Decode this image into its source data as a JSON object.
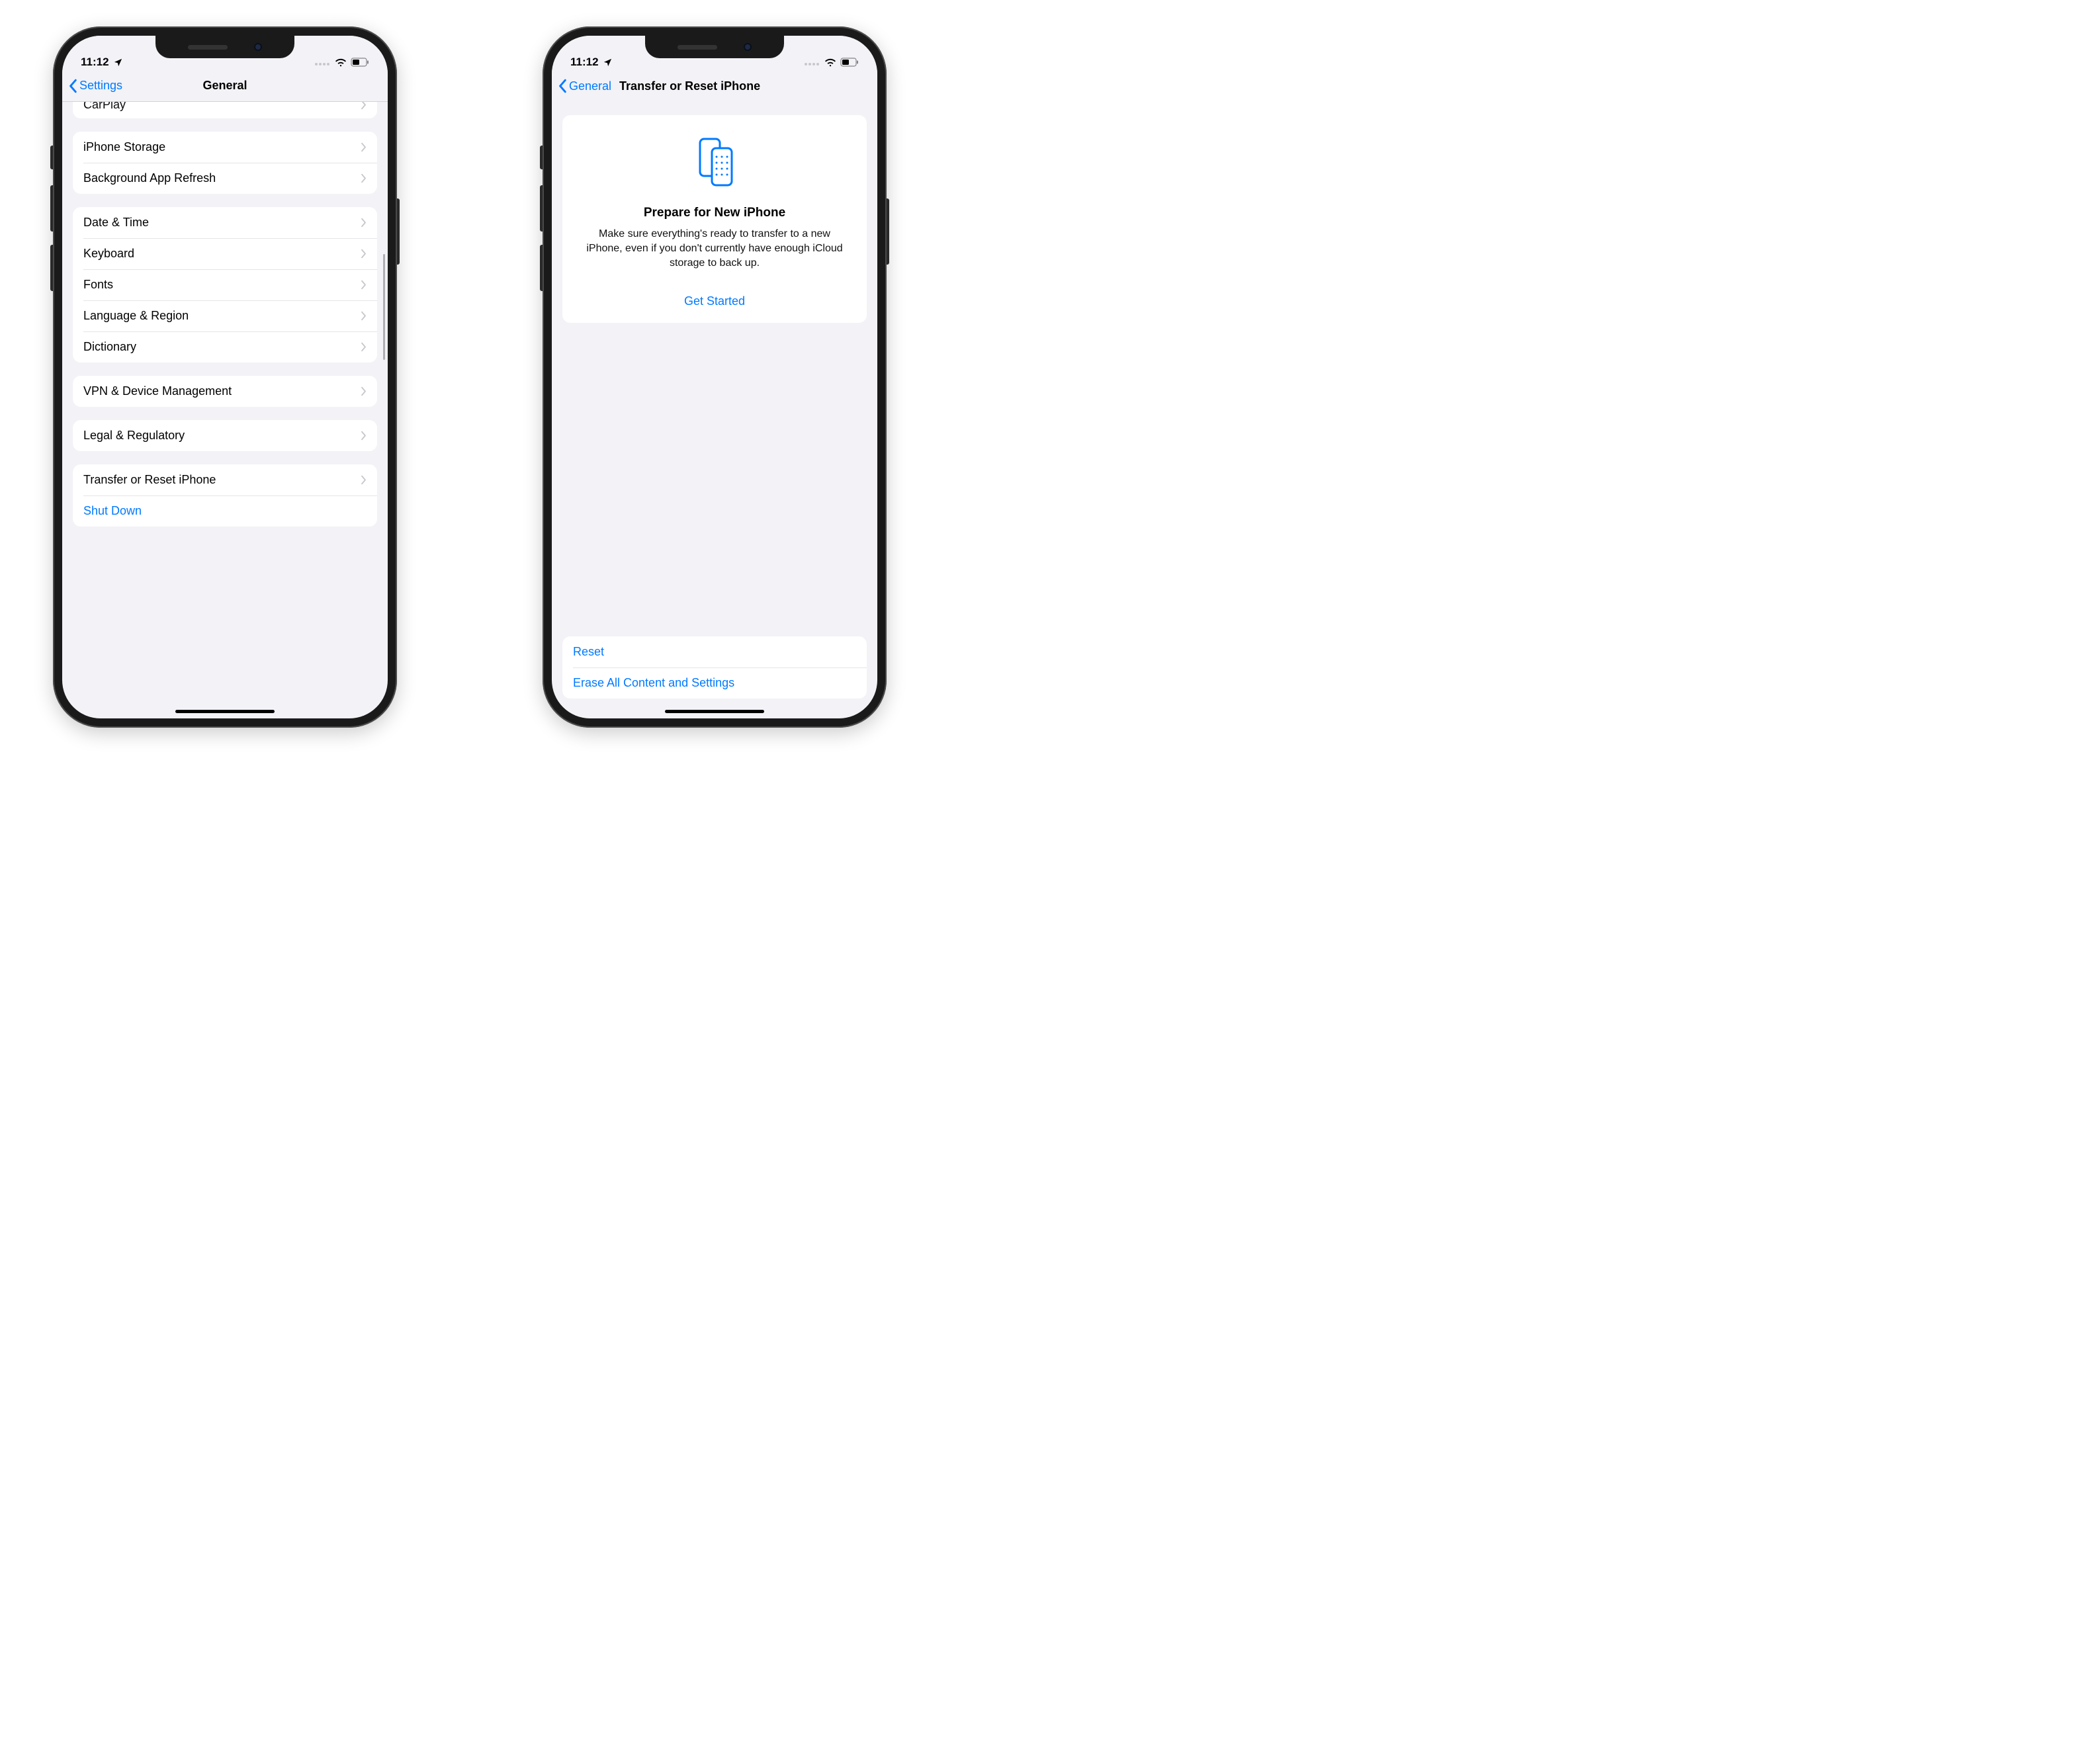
{
  "status": {
    "time": "11:12"
  },
  "phone1": {
    "nav": {
      "back": "Settings",
      "title": "General"
    },
    "partial_row": "CarPlay",
    "groups": [
      {
        "rows": [
          {
            "label": "iPhone Storage"
          },
          {
            "label": "Background App Refresh"
          }
        ]
      },
      {
        "rows": [
          {
            "label": "Date & Time"
          },
          {
            "label": "Keyboard"
          },
          {
            "label": "Fonts"
          },
          {
            "label": "Language & Region"
          },
          {
            "label": "Dictionary"
          }
        ]
      },
      {
        "rows": [
          {
            "label": "VPN & Device Management"
          }
        ]
      },
      {
        "rows": [
          {
            "label": "Legal & Regulatory"
          }
        ]
      },
      {
        "rows": [
          {
            "label": "Transfer or Reset iPhone"
          },
          {
            "label": "Shut Down",
            "blue": true,
            "no_chevron": true
          }
        ]
      }
    ]
  },
  "phone2": {
    "nav": {
      "back": "General",
      "title": "Transfer or Reset iPhone"
    },
    "card": {
      "heading": "Prepare for New iPhone",
      "body": "Make sure everything's ready to transfer to a new iPhone, even if you don't currently have enough iCloud storage to back up.",
      "cta": "Get Started"
    },
    "bottom_group": {
      "rows": [
        {
          "label": "Reset"
        },
        {
          "label": "Erase All Content and Settings"
        }
      ]
    }
  }
}
